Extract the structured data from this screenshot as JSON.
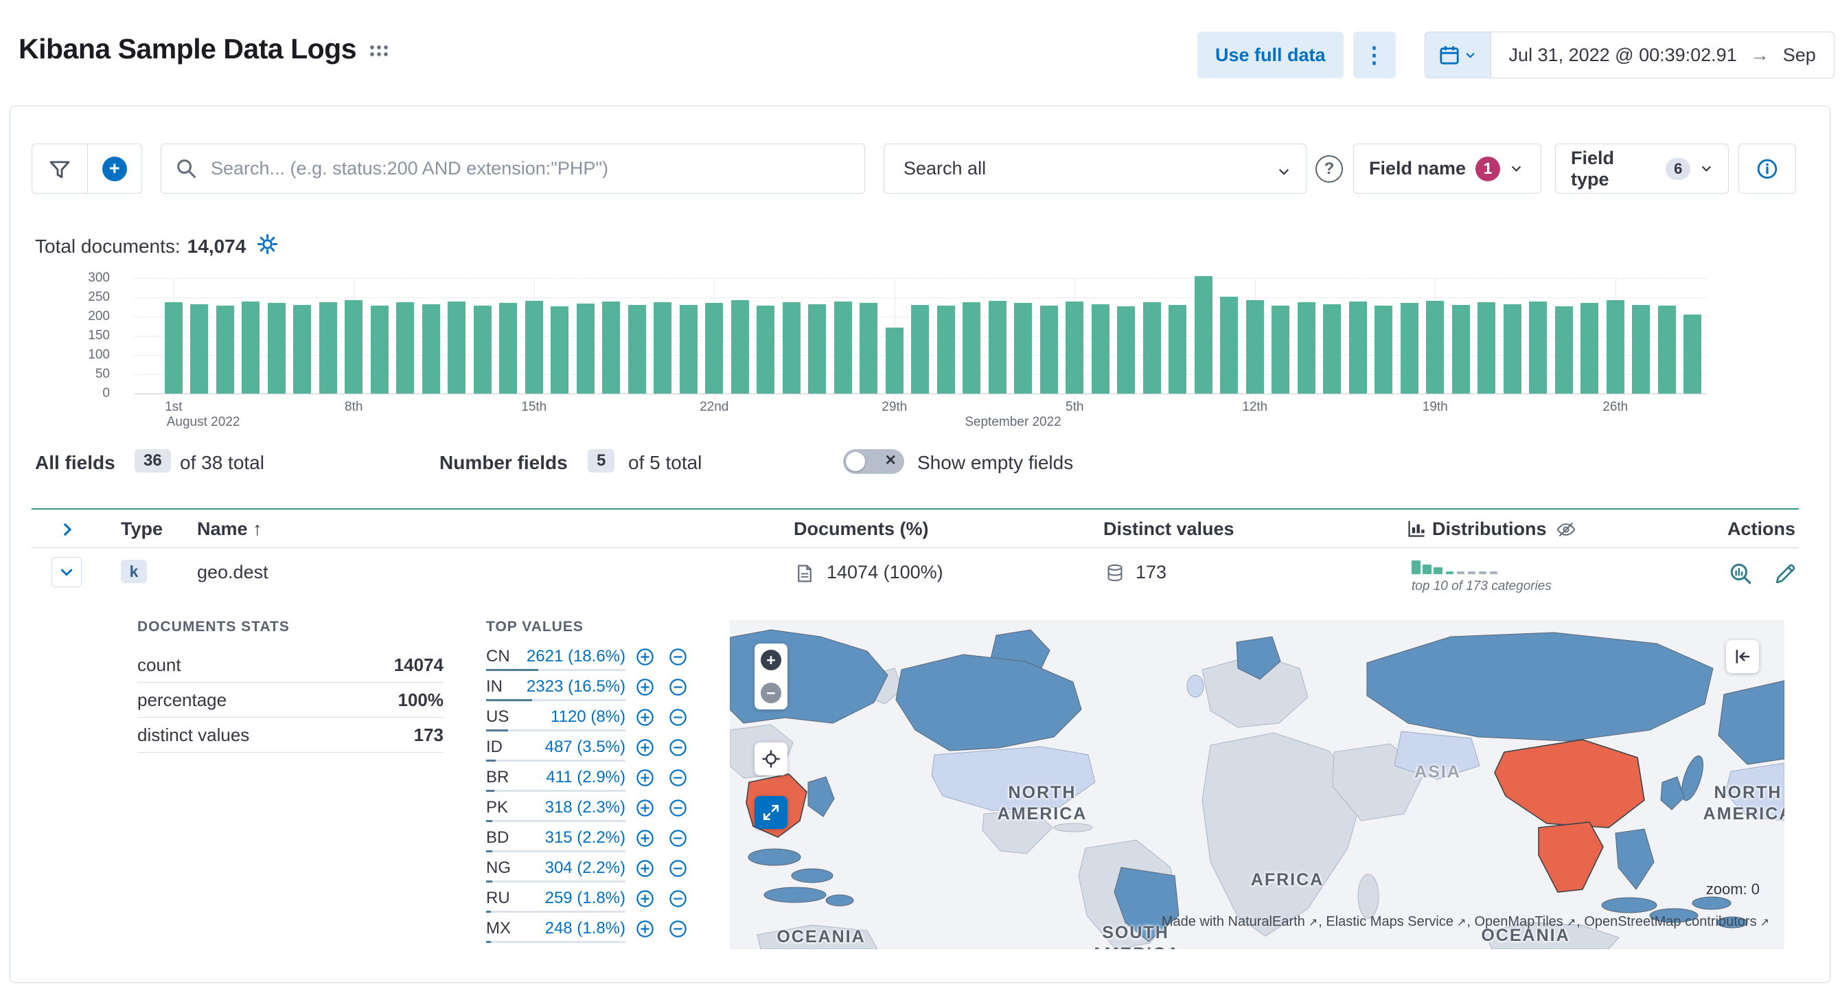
{
  "header": {
    "title": "Kibana Sample Data Logs",
    "use_full_data_label": "Use full data",
    "dots_menu": "⋮",
    "date_start": "Jul 31, 2022 @ 00:39:02.91",
    "date_arrow": "→",
    "date_end": "Sep"
  },
  "toolbar": {
    "search_placeholder": "Search... (e.g. status:200 AND extension:\"PHP\")",
    "search_all_value": "Search all",
    "help_glyph": "?",
    "field_name_label": "Field name",
    "field_name_count": "1",
    "field_type_label": "Field type",
    "field_type_count": "6"
  },
  "summary": {
    "total_documents_label": "Total documents:",
    "total_documents_value": "14,074"
  },
  "chart_data": {
    "type": "bar",
    "title": "Total documents over time",
    "xlabel": "",
    "ylabel": "",
    "ylim": [
      0,
      300
    ],
    "yticks": [
      0,
      50,
      100,
      150,
      200,
      250,
      300
    ],
    "bar_color": "#54B399",
    "grid": true,
    "x_unit": "day",
    "x_start": "Aug 1, 2022",
    "ticks": [
      {
        "index": 0,
        "label": "1st"
      },
      {
        "index": 7,
        "label": "8th"
      },
      {
        "index": 14,
        "label": "15th"
      },
      {
        "index": 21,
        "label": "22nd"
      },
      {
        "index": 28,
        "label": "29th"
      },
      {
        "index": 35,
        "label": "5th"
      },
      {
        "index": 42,
        "label": "12th"
      },
      {
        "index": 49,
        "label": "19th"
      },
      {
        "index": 56,
        "label": "26th"
      }
    ],
    "month_labels": [
      {
        "index": 0,
        "label": "August 2022"
      },
      {
        "index": 31,
        "label": "September 2022"
      }
    ],
    "values": [
      238,
      232,
      228,
      240,
      235,
      230,
      237,
      242,
      229,
      238,
      233,
      240,
      228,
      236,
      241,
      227,
      234,
      239,
      231,
      237,
      230,
      235,
      242,
      228,
      238,
      232,
      239,
      236,
      172,
      231,
      228,
      237,
      241,
      235,
      229,
      240,
      233,
      226,
      238,
      231,
      305,
      252,
      242,
      229,
      237,
      232,
      240,
      228,
      235,
      241,
      230,
      238,
      233,
      239,
      227,
      236,
      242,
      231,
      229,
      205
    ]
  },
  "fields_bar": {
    "all_fields_label": "All fields",
    "all_fields_count": "36",
    "all_fields_total": "of 38 total",
    "number_fields_label": "Number fields",
    "number_fields_count": "5",
    "number_fields_total": "of 5 total",
    "show_empty_label": "Show empty fields"
  },
  "table": {
    "headers": {
      "type": "Type",
      "name": "Name",
      "sort_arrow": "↑",
      "documents": "Documents (%)",
      "distinct": "Distinct values",
      "distributions": "Distributions",
      "actions": "Actions"
    },
    "row": {
      "type_token": "k",
      "name": "geo.dest",
      "documents": "14074 (100%)",
      "distinct": "173",
      "distribution_caption": "top 10 of 173 categories"
    }
  },
  "details": {
    "doc_stats_title": "DOCUMENTS STATS",
    "doc_stats": [
      {
        "label": "count",
        "value": "14074"
      },
      {
        "label": "percentage",
        "value": "100%"
      },
      {
        "label": "distinct values",
        "value": "173"
      }
    ],
    "top_values_title": "TOP VALUES",
    "top_values": [
      {
        "code": "CN",
        "display": "2621 (18.6%)",
        "pct": 18.6
      },
      {
        "code": "IN",
        "display": "2323 (16.5%)",
        "pct": 16.5
      },
      {
        "code": "US",
        "display": "1120 (8%)",
        "pct": 8
      },
      {
        "code": "ID",
        "display": "487 (3.5%)",
        "pct": 3.5
      },
      {
        "code": "BR",
        "display": "411 (2.9%)",
        "pct": 2.9
      },
      {
        "code": "PK",
        "display": "318 (2.3%)",
        "pct": 2.3
      },
      {
        "code": "BD",
        "display": "315 (2.2%)",
        "pct": 2.2
      },
      {
        "code": "NG",
        "display": "304 (2.2%)",
        "pct": 2.2
      },
      {
        "code": "RU",
        "display": "259 (1.8%)",
        "pct": 1.8
      },
      {
        "code": "MX",
        "display": "248 (1.8%)",
        "pct": 1.8
      }
    ]
  },
  "map": {
    "labels": {
      "north1a": "NORTH",
      "north1b": "AMERICA",
      "asia": "ASIA",
      "africa": "AFRICA",
      "south1a": "SOUTH",
      "south1b": "AMERICA",
      "oceania1": "OCEANIA",
      "oceania2": "OCEANIA",
      "north2a": "NORTH",
      "north2b": "AMERICA"
    },
    "zoom_label": "zoom: 0",
    "attribution": [
      "Made with NaturalEarth",
      "Elastic Maps Service",
      "OpenMapTiles",
      "OpenStreetMap contributors"
    ]
  },
  "colors": {
    "bar": "#54B399",
    "primary": "#0071C2",
    "accent_badge": "#B9366E",
    "country_high": "#E7664C",
    "country_mid": "#6092C0",
    "country_low": "#CBD7EE"
  }
}
